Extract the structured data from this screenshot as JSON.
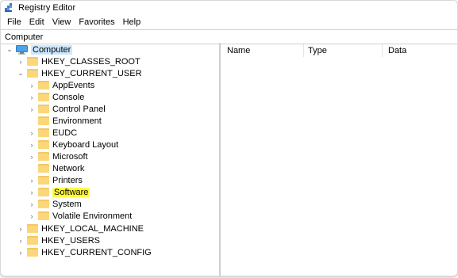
{
  "window": {
    "title": "Registry Editor"
  },
  "menu": [
    "File",
    "Edit",
    "View",
    "Favorites",
    "Help"
  ],
  "address": "Computer",
  "tree": {
    "root": "Computer",
    "hives": [
      {
        "label": "HKEY_CLASSES_ROOT",
        "expanded": false
      },
      {
        "label": "HKEY_CURRENT_USER",
        "expanded": true,
        "children": [
          {
            "label": "AppEvents",
            "expandable": true
          },
          {
            "label": "Console",
            "expandable": true
          },
          {
            "label": "Control Panel",
            "expandable": true
          },
          {
            "label": "Environment",
            "expandable": false
          },
          {
            "label": "EUDC",
            "expandable": true
          },
          {
            "label": "Keyboard Layout",
            "expandable": true
          },
          {
            "label": "Microsoft",
            "expandable": true
          },
          {
            "label": "Network",
            "expandable": false
          },
          {
            "label": "Printers",
            "expandable": true
          },
          {
            "label": "Software",
            "expandable": true,
            "highlighted": true
          },
          {
            "label": "System",
            "expandable": true
          },
          {
            "label": "Volatile Environment",
            "expandable": true
          }
        ]
      },
      {
        "label": "HKEY_LOCAL_MACHINE",
        "expanded": false
      },
      {
        "label": "HKEY_USERS",
        "expanded": false
      },
      {
        "label": "HKEY_CURRENT_CONFIG",
        "expanded": false
      }
    ]
  },
  "columns": {
    "name": "Name",
    "type": "Type",
    "data": "Data"
  },
  "colors": {
    "selection": "#cce8ff",
    "highlight": "#fffb3c",
    "folder": "#fbd77a"
  }
}
